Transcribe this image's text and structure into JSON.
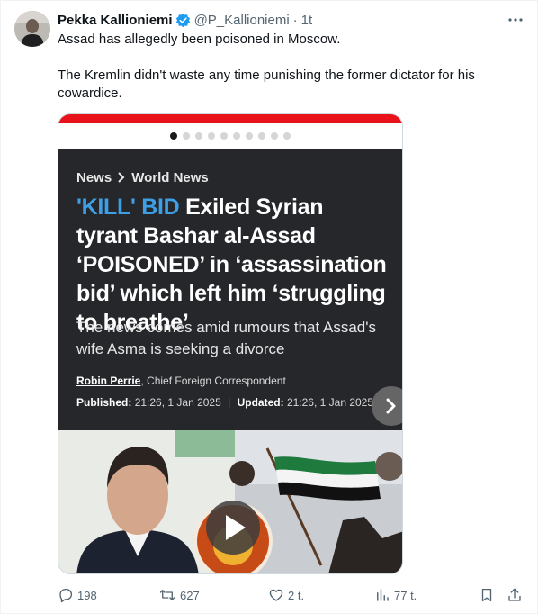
{
  "author": {
    "name": "Pekka Kallioniemi",
    "handle": "@P_Kallioniemi",
    "separator": "·",
    "time": "1t"
  },
  "tweet": {
    "paragraphs": [
      "Assad has allegedly been poisoned in Moscow.",
      "The Kremlin didn't waste any time punishing the former dictator for his cowardice."
    ]
  },
  "media": {
    "breadcrumb": [
      "News",
      "World News"
    ],
    "kicker": "'KILL' BID",
    "headline": "Exiled Syrian tyrant Bashar al-Assad ‘POISONED’ in ‘assassination bid’ which left him ‘struggling to breathe’",
    "standfirst": "The news comes amid rumours that Assad's wife Asma is seeking a divorce",
    "byline_author": "Robin Perrie",
    "byline_role": ", Chief Foreign Correspondent",
    "published_label": "Published:",
    "published": "21:26, 1 Jan 2025",
    "updated_label": "Updated:",
    "updated": "21:26, 1 Jan 2025",
    "date_sep": "|",
    "carousel_total": 10,
    "carousel_active": 0,
    "colors": {
      "accent": "#e8121b",
      "kicker": "#3e9fe6",
      "panel": "#25272b"
    }
  },
  "actions": {
    "replies": "198",
    "reposts": "627",
    "likes": "2 t.",
    "views": "77 t."
  },
  "icons": [
    "verified-badge-icon",
    "more-icon",
    "reply-icon",
    "repost-icon",
    "like-icon",
    "views-icon",
    "bookmark-icon",
    "share-icon",
    "chevron-right-icon",
    "play-icon"
  ]
}
